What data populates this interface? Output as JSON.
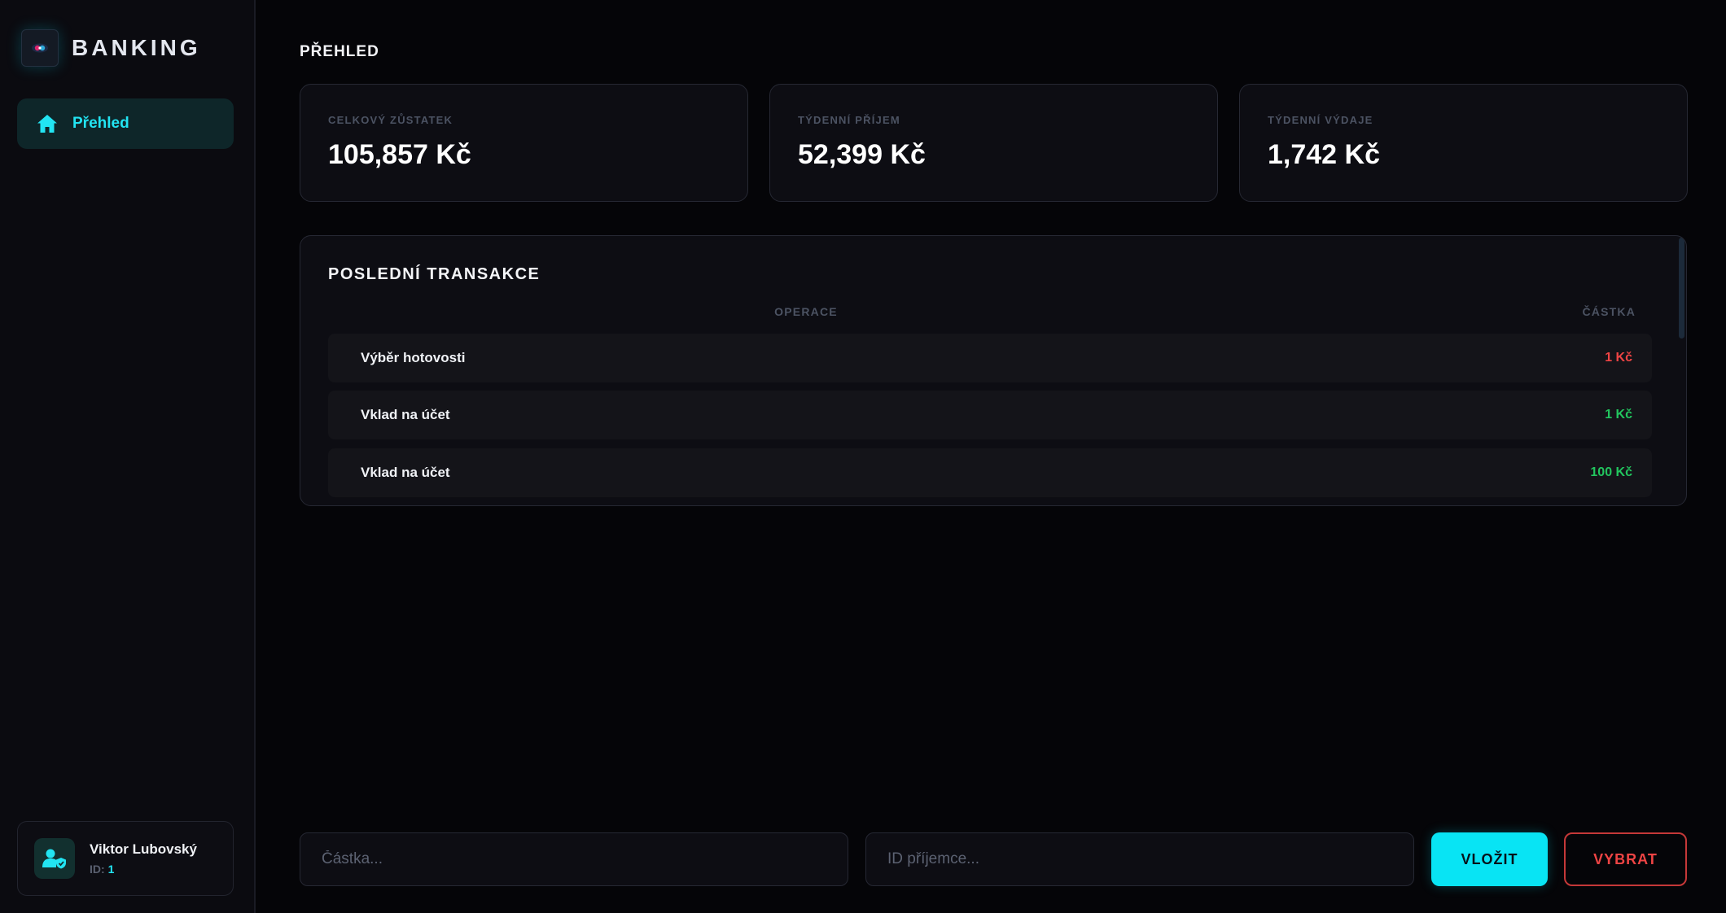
{
  "brand": {
    "name": "BANKING"
  },
  "sidebar": {
    "items": [
      {
        "label": "Přehled",
        "icon": "home-icon",
        "active": true
      }
    ]
  },
  "user": {
    "name": "Viktor Lubovský",
    "id_label": "ID:",
    "id_value": "1",
    "icon": "user-shield-icon"
  },
  "page": {
    "title": "PŘEHLED"
  },
  "stats": [
    {
      "label": "CELKOVÝ ZŮSTATEK",
      "value": "105,857 Kč"
    },
    {
      "label": "TÝDENNÍ PŘÍJEM",
      "value": "52,399 Kč"
    },
    {
      "label": "TÝDENNÍ VÝDAJE",
      "value": "1,742 Kč"
    }
  ],
  "transactions": {
    "title": "POSLEDNÍ TRANSAKCE",
    "columns": {
      "operation": "OPERACE",
      "amount": "ČÁSTKA"
    },
    "rows": [
      {
        "operation": "Výběr hotovosti",
        "amount": "1 Kč",
        "type": "negative"
      },
      {
        "operation": "Vklad na účet",
        "amount": "1 Kč",
        "type": "positive"
      },
      {
        "operation": "Vklad na účet",
        "amount": "100 Kč",
        "type": "positive"
      }
    ]
  },
  "actions": {
    "amount_placeholder": "Částka...",
    "recipient_placeholder": "ID příjemce...",
    "deposit_label": "VLOŽIT",
    "withdraw_label": "VYBRAT"
  },
  "colors": {
    "accent": "#08e4f4",
    "negative": "#ef4444",
    "positive": "#22c55e",
    "background": "#050508"
  }
}
